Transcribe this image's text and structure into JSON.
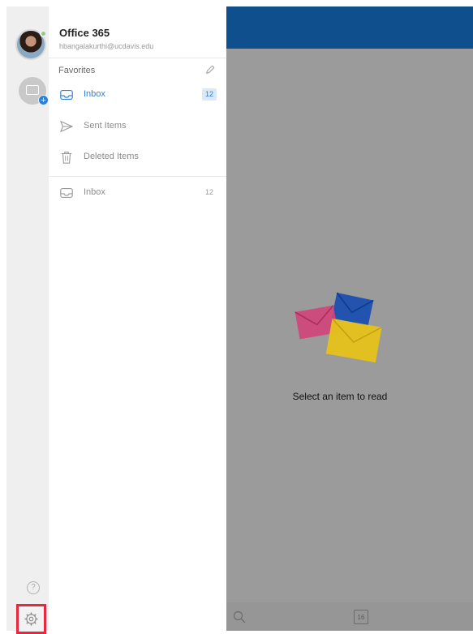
{
  "account": {
    "name": "Office 365",
    "email": "hbangalakurthi@ucdavis.edu"
  },
  "folders": {
    "favorites_label": "Favorites",
    "items": [
      {
        "label": "Inbox",
        "count": "12",
        "icon": "inbox-icon",
        "active": true
      },
      {
        "label": "Sent Items",
        "count": "",
        "icon": "sent-icon",
        "active": false
      },
      {
        "label": "Deleted Items",
        "count": "",
        "icon": "trash-icon",
        "active": false
      },
      {
        "label": "Inbox",
        "count": "12",
        "icon": "inbox-icon",
        "active": false
      }
    ]
  },
  "reading_pane": {
    "empty_message": "Select an item to read"
  },
  "bottom_bar": {
    "calendar_day": "16"
  },
  "icons": {
    "help": "?",
    "plus": "+"
  },
  "colors": {
    "accent": "#2e7fd6",
    "header": "#0f4f8e",
    "highlight_box": "#e8283d",
    "reading_bg": "#9b9b9b"
  }
}
